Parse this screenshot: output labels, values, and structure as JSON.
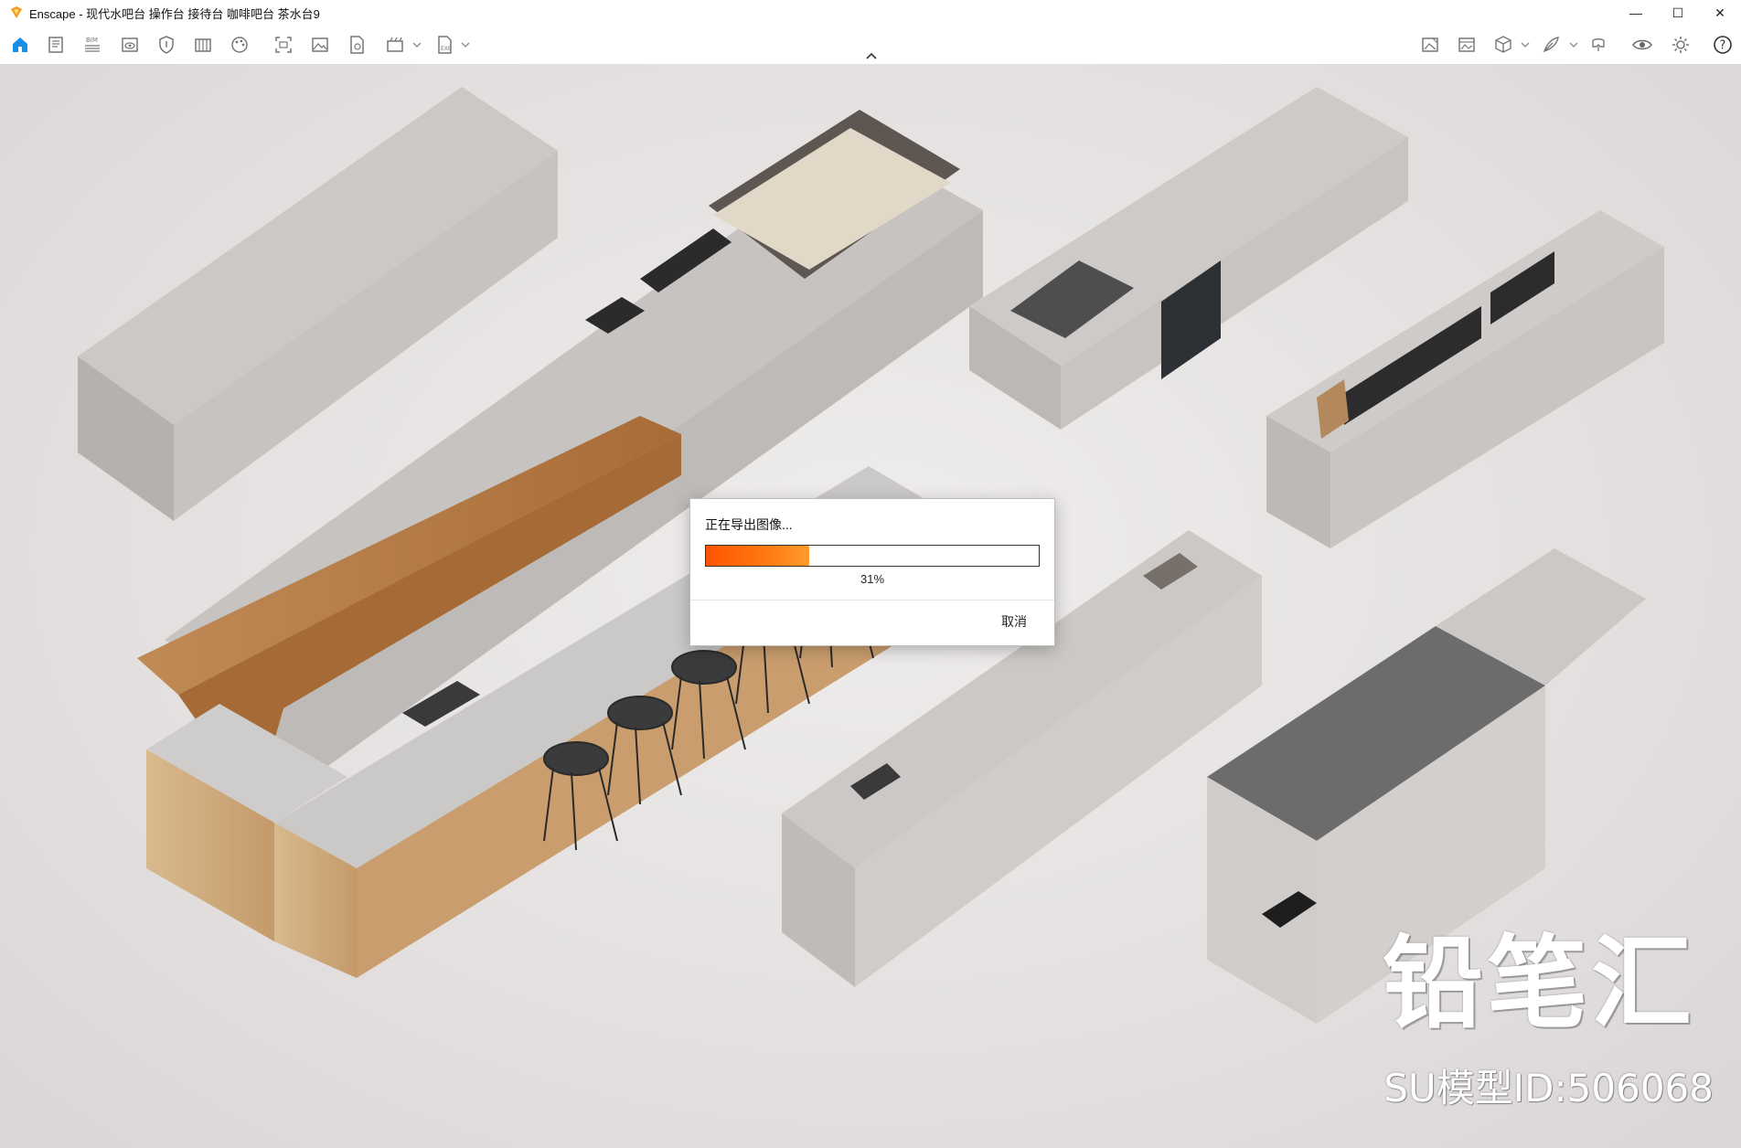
{
  "window": {
    "title": "Enscape - 现代水吧台 操作台 接待台 咖啡吧台 茶水台9",
    "minimize_glyph": "—",
    "maximize_glyph": "☐",
    "close_glyph": "✕"
  },
  "toolbar": {
    "left_icons": [
      "home-icon",
      "notes-icon",
      "bim-icon",
      "view-icon",
      "shield-icon",
      "book-icon",
      "palette-icon",
      "screenshot-icon",
      "image-icon",
      "document-icon",
      "render-icon",
      "exe-export-icon"
    ],
    "right_icons": [
      "image-gallery-icon",
      "photo-icon",
      "cube-icon",
      "feather-icon",
      "vr-headset-icon",
      "visibility-icon",
      "settings-icon",
      "help-icon"
    ],
    "help_glyph": "?"
  },
  "dialog": {
    "title": "正在导出图像...",
    "progress_percent": 31,
    "progress_label": "31%",
    "cancel_label": "取消",
    "accent_color": "#ff6a0a"
  },
  "watermark": {
    "brand": "铅笔汇",
    "model_id": "SU模型ID:506068"
  }
}
